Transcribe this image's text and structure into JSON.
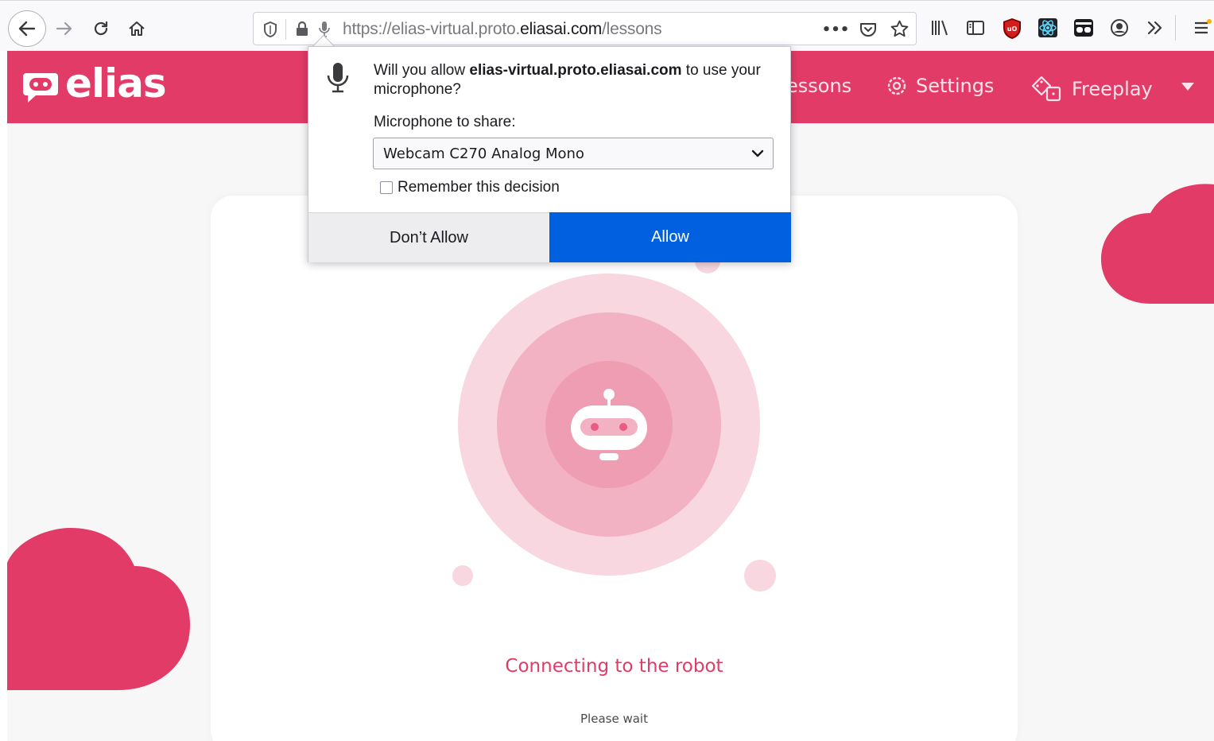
{
  "browser": {
    "url_prefix": "https://elias-virtual.proto.",
    "url_domain": "eliasai.com",
    "url_path": "/lessons"
  },
  "app": {
    "logo": "elias",
    "nav": [
      {
        "label": "essons",
        "icon": "book-icon"
      },
      {
        "label": "Settings",
        "icon": "gear-icon"
      },
      {
        "label": "Freeplay",
        "icon": "dice-icon"
      }
    ],
    "brand_color": "#e23b67"
  },
  "permission": {
    "question_pre": "Will you allow ",
    "question_domain": "elias-virtual.proto.eliasai.com",
    "question_post": " to use your microphone?",
    "mic_label": "Microphone to share:",
    "mic_selected": "Webcam C270 Analog Mono",
    "remember_label": "Remember this decision",
    "remember_checked": false,
    "dont_allow_label": "Don’t Allow",
    "allow_label": "Allow"
  },
  "status": {
    "title": "Connecting to the robot",
    "subtitle": "Please wait"
  }
}
